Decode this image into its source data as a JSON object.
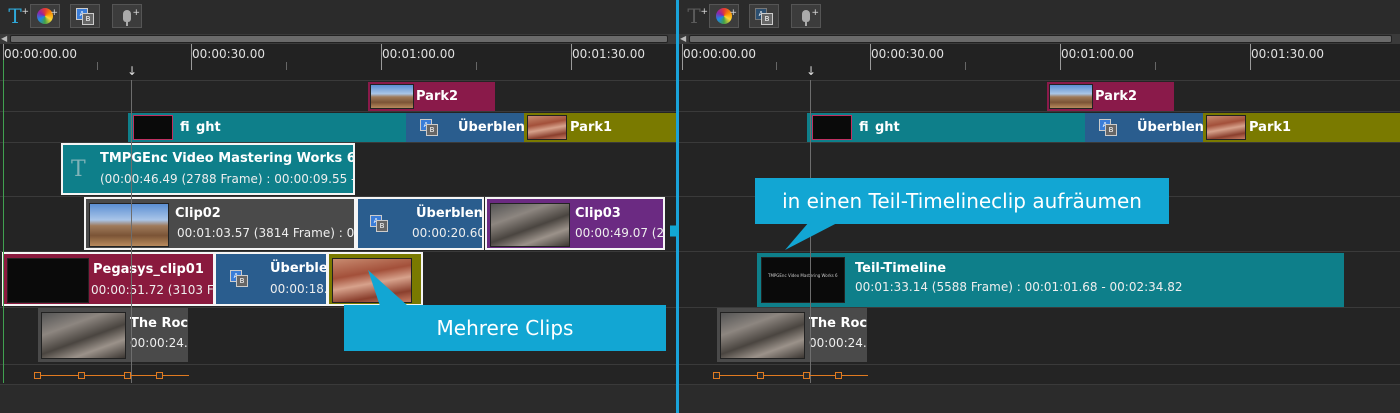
{
  "toolbar": {
    "left": {
      "buttons": [
        {
          "icon": "text-add-icon",
          "plus": "+"
        },
        {
          "icon": "effect-add-icon",
          "plus": "+"
        },
        {
          "icon": "transition-icon",
          "plus": ""
        },
        {
          "icon": "microphone-icon",
          "plus": "+"
        }
      ]
    },
    "right": {
      "buttons": [
        {
          "icon": "text-add-icon",
          "plus": "+"
        },
        {
          "icon": "effect-add-icon",
          "plus": "+"
        },
        {
          "icon": "transition-icon",
          "plus": ""
        },
        {
          "icon": "microphone-icon",
          "plus": "+"
        }
      ]
    },
    "T_glyph": "T",
    "a_glyph": "A",
    "b_glyph": "B"
  },
  "ruler": {
    "labels": [
      "00:00:00.00",
      "00:00:30.00",
      "00:01:00.00",
      "00:01:30.00"
    ],
    "cursor_glyph": "↓"
  },
  "left": {
    "park2": {
      "name": "Park2"
    },
    "fight": {
      "name": "fi",
      "name2": "ght"
    },
    "uberblend_top": {
      "name": "Überblend"
    },
    "park1": {
      "name": "Park1"
    },
    "title_clip": {
      "glyph": "T",
      "name": "TMPGEnc Video Mastering Works 6",
      "info": "(00:00:46.49 (2788 Frame) :  00:00:09.55 -"
    },
    "clip02": {
      "name": "Clip02",
      "info": "00:01:03.57 (3814 Frame) :  00"
    },
    "uberblend_mid": {
      "name": "Überblend",
      "info": "00:00:20.60"
    },
    "clip03": {
      "name": "Clip03",
      "info": "00:00:49.07 (2"
    },
    "pegasys": {
      "name": "Pegasys_clip01",
      "info": "00:00:51.72 (3103 Frame"
    },
    "uberblend_low": {
      "name": "Überblend",
      "info": "00:00:18."
    },
    "rock": {
      "name": "The Rock",
      "info": "00:00:24."
    },
    "callout": "Mehrere Clips"
  },
  "right": {
    "park2": {
      "name": "Park2"
    },
    "fight": {
      "name": "fi",
      "name2": "ght"
    },
    "uberblend_top": {
      "name": "Überblend"
    },
    "park1": {
      "name": "Park1"
    },
    "teil": {
      "name": "Teil-Timeline",
      "info": "00:01:33.14 (5588 Frame) :  00:01:01.68 - 00:02:34.82",
      "thumb_text": "TMPGEnc Video Mastering Works 6"
    },
    "rock": {
      "name": "The Rock",
      "info": "00:00:24."
    },
    "callout": "in einen Teil-Timelineclip aufräumen"
  },
  "colors": {
    "accent": "#12a6d3",
    "teal_clip": "#0e7f8a",
    "park2": "#8a1a4a",
    "park1": "#7a7a00",
    "transition": "#2a5d8e",
    "clip03": "#6b2a82",
    "pegasys": "#8a1a3e",
    "gray_clip": "#4a4a4a"
  }
}
